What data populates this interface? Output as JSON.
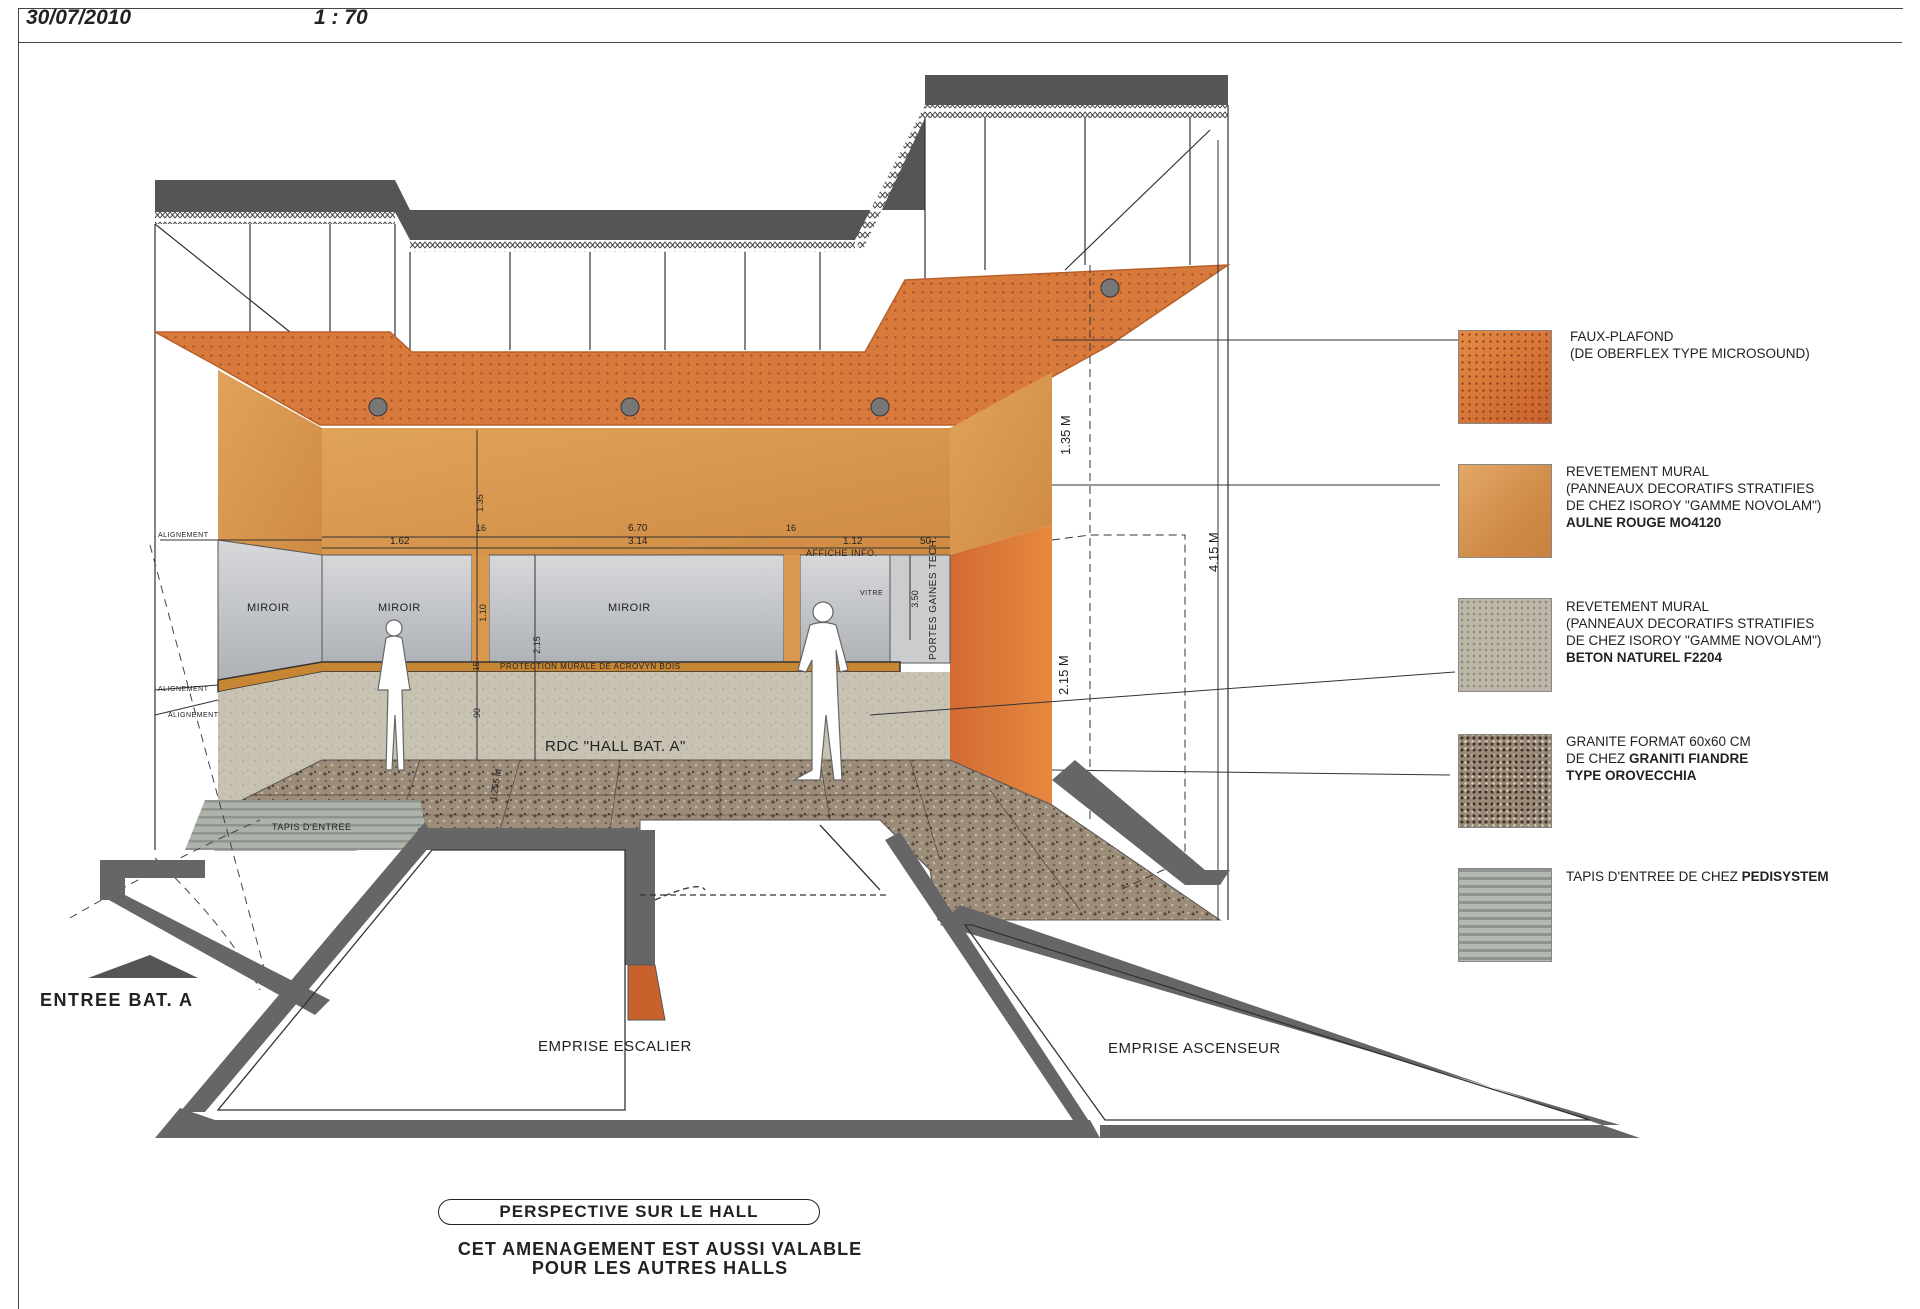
{
  "header": {
    "date": "30/07/2010",
    "scale": "1 : 70"
  },
  "labels": {
    "entree": "ENTREE BAT. A",
    "escalier": "EMPRISE ESCALIER",
    "ascenseur": "EMPRISE ASCENSEUR",
    "hall": "RDC  \"HALL BAT. A\"",
    "miroir": "MIROIR",
    "vitre": "VITRE",
    "affiche": "AFFICHE INFO.",
    "protection": "PROTECTION MURALE DE ACROVYN BOIS",
    "tapis": "TAPIS D'ENTREE",
    "portes": "PORTES GAINES TECH.",
    "alignement": "ALIGNEMENT"
  },
  "dimensions": {
    "h_total": "4.15 M",
    "h_top": "1.35 M",
    "h_bottom": "2.15 M",
    "w_total": "6.70",
    "w_a": "1.62",
    "w_b": "3.14",
    "w_c": "1.12",
    "w_d": "50",
    "w_e": "16",
    "w_f": "16",
    "v_a": "1.35",
    "v_b": "1.10",
    "v_c": "2.15",
    "v_d": "90",
    "v_e": "15",
    "v_f": "3.50",
    "depth": "1.255 M"
  },
  "legend": [
    {
      "lines": [
        "FAUX-PLAFOND",
        "(DE OBERFLEX TYPE MICROSOUND)"
      ],
      "bold_line": "",
      "bold_suffix": ""
    },
    {
      "lines": [
        "REVETEMENT MURAL",
        "(PANNEAUX DECORATIFS STRATIFIES",
        "DE CHEZ ISOROY \"GAMME NOVOLAM\")"
      ],
      "bold_line": "AULNE ROUGE MO4120",
      "bold_suffix": ""
    },
    {
      "lines": [
        "REVETEMENT MURAL",
        "(PANNEAUX DECORATIFS STRATIFIES",
        "DE CHEZ ISOROY \"GAMME NOVOLAM\")"
      ],
      "bold_line": "BETON NATUREL F2204",
      "bold_suffix": ""
    },
    {
      "lines": [
        "GRANITE FORMAT 60x60 CM",
        "DE CHEZ "
      ],
      "bold_suffix": "GRANITI FIANDRE",
      "bold_line": "TYPE OROVECCHIA"
    },
    {
      "lines": [
        "TAPIS D'ENTREE DE CHEZ "
      ],
      "bold_suffix": "PEDISYSTEM",
      "bold_line": ""
    }
  ],
  "title": "PERSPECTIVE SUR LE HALL",
  "note_line1": "CET AMENAGEMENT EST AUSSI VALABLE",
  "note_line2": "POUR LES AUTRES HALLS",
  "colors": {
    "ceiling": "#d87a3c",
    "wood": "#d9984e",
    "concrete": "#c9c3b4",
    "granite": "#9a8a78",
    "wall": "#666666",
    "copper": "#c8622c"
  }
}
